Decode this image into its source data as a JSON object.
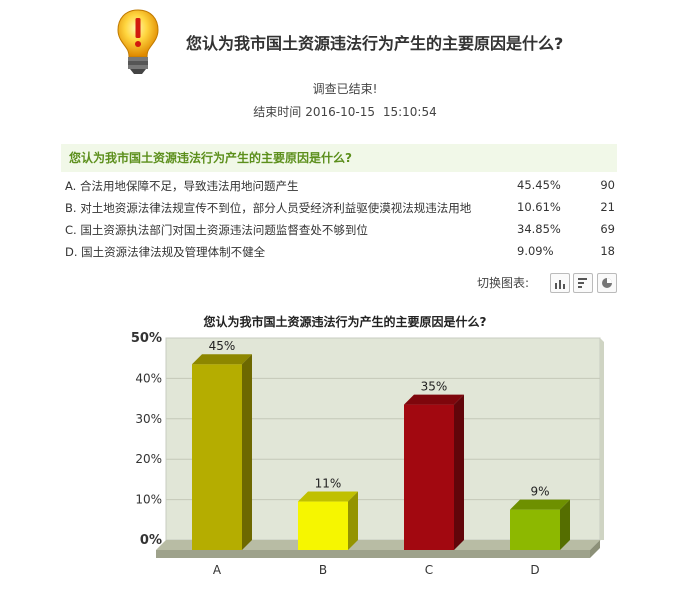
{
  "survey": {
    "title": "您认为我市国土资源违法行为产生的主要原因是什么?",
    "status": "调查已结束!",
    "end_time_label": "结束时间",
    "end_date": "2016-10-15",
    "end_clock": "15:10:54"
  },
  "question": {
    "title": "您认为我市国土资源违法行为产生的主要原因是什么?",
    "options": [
      {
        "text": "A. 合法用地保障不足，导致违法用地问题产生",
        "percent": "45.45%",
        "count": "90"
      },
      {
        "text": "B. 对土地资源法律法规宣传不到位，部分人员受经济利益驱使漠视法规违法用地",
        "percent": "10.61%",
        "count": "21"
      },
      {
        "text": "C. 国土资源执法部门对国土资源违法问题监督查处不够到位",
        "percent": "34.85%",
        "count": "69"
      },
      {
        "text": "D. 国土资源法律法规及管理体制不健全",
        "percent": "9.09%",
        "count": "18"
      }
    ]
  },
  "toolbar": {
    "switch_label": "切换图表:",
    "buttons": [
      "bar-chart-icon",
      "horizontal-bar-icon",
      "pie-chart-icon"
    ]
  },
  "chart_data": {
    "type": "bar",
    "title": "您认为我市国土资源违法行为产生的主要原因是什么?",
    "categories": [
      "A",
      "B",
      "C",
      "D"
    ],
    "values": [
      45,
      11,
      35,
      9
    ],
    "value_labels": [
      "45%",
      "11%",
      "35%",
      "9%"
    ],
    "colors": [
      "#b5ad00",
      "#f6f600",
      "#a20810",
      "#8db800"
    ],
    "ylim": [
      0,
      50
    ],
    "yticks": [
      "0%",
      "10%",
      "20%",
      "30%",
      "40%",
      "50%"
    ],
    "grid": true,
    "xlabel": "",
    "ylabel": ""
  }
}
